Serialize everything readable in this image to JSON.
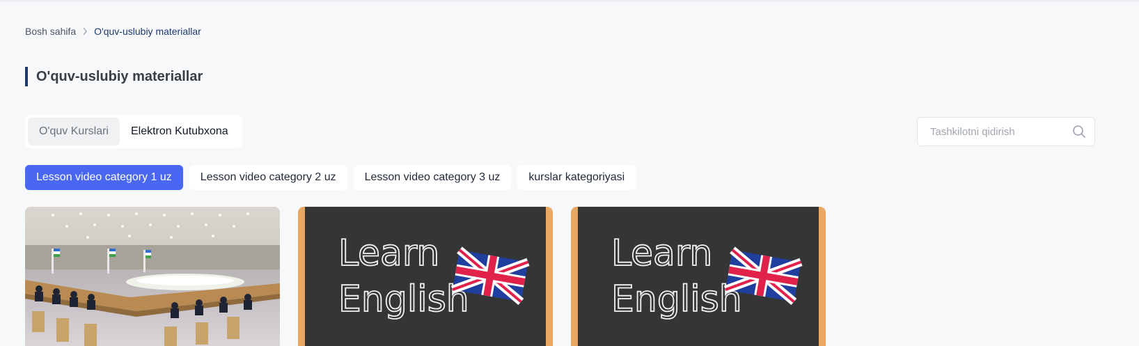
{
  "breadcrumb": {
    "home": "Bosh sahifa",
    "current": "O'quv-uslubiy materiallar"
  },
  "page_title": "O'quv-uslubiy materiallar",
  "tabs": [
    {
      "label": "O'quv Kurslari",
      "active": true
    },
    {
      "label": "Elektron Kutubxona",
      "active": false
    }
  ],
  "search": {
    "placeholder": "Tashkilotni qidirish",
    "value": ""
  },
  "categories": [
    {
      "label": "Lesson video category 1 uz",
      "active": true
    },
    {
      "label": "Lesson video category 2 uz",
      "active": false
    },
    {
      "label": "Lesson video category 3 uz",
      "active": false
    },
    {
      "label": "kurslar kategoriyasi",
      "active": false
    }
  ],
  "cards": [
    {
      "image": "conference-hall-photo"
    },
    {
      "image": "learn-english-chalkboard",
      "text_line1": "Learn",
      "text_line2": "English"
    },
    {
      "image": "learn-english-chalkboard",
      "text_line1": "Learn",
      "text_line2": "English"
    }
  ],
  "colors": {
    "accent": "#4a67f1",
    "title_bar": "#1d3a6e",
    "background": "#f7f8fa"
  },
  "icons": {
    "breadcrumb_separator": "chevron-right-icon",
    "search": "search-icon"
  }
}
